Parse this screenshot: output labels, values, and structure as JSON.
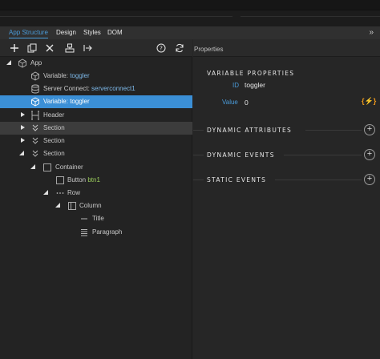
{
  "tabs": [
    {
      "label": "App Structure",
      "active": true
    },
    {
      "label": "Design",
      "active": false
    },
    {
      "label": "Styles",
      "active": false
    },
    {
      "label": "DOM",
      "active": false
    }
  ],
  "toolbar": {
    "icons": [
      "plus-icon",
      "copy-icon",
      "close-icon",
      "component-icon",
      "insert-arrow-icon",
      "help-icon",
      "refresh-icon"
    ]
  },
  "tree": [
    {
      "label": "App",
      "accent": "",
      "icon": "cube-icon",
      "twisty": "open"
    },
    {
      "label": "Variable: ",
      "accent": "toggler",
      "icon": "cube-icon",
      "twisty": ""
    },
    {
      "label": "Server Connect: ",
      "accent": "serverconnect1",
      "icon": "database-icon",
      "twisty": ""
    },
    {
      "label": "Variable: ",
      "accent": "toggler",
      "icon": "cube-icon",
      "twisty": "",
      "selected": true
    },
    {
      "label": "Header",
      "accent": "",
      "icon": "header-icon",
      "twisty": "closed"
    },
    {
      "label": "Section",
      "accent": "",
      "icon": "section-icon",
      "twisty": "closed",
      "highlight": true
    },
    {
      "label": "Section",
      "accent": "",
      "icon": "section-icon",
      "twisty": "closed"
    },
    {
      "label": "Section",
      "accent": "",
      "icon": "section-icon",
      "twisty": "open"
    },
    {
      "label": "Container",
      "accent": "",
      "icon": "container-icon",
      "twisty": "open"
    },
    {
      "label": "Button ",
      "accent": "btn1",
      "icon": "button-icon",
      "twisty": ""
    },
    {
      "label": "Row",
      "accent": "",
      "icon": "row-icon",
      "twisty": "open"
    },
    {
      "label": "Column",
      "accent": "",
      "icon": "column-icon",
      "twisty": "open"
    },
    {
      "label": "Title",
      "accent": "",
      "icon": "title-icon",
      "twisty": ""
    },
    {
      "label": "Paragraph",
      "accent": "",
      "icon": "paragraph-icon",
      "twisty": ""
    }
  ],
  "properties": {
    "title": "Properties",
    "section_variable": "VARIABLE PROPERTIES",
    "id_label": "ID",
    "id_value": "toggler",
    "value_label": "Value",
    "value_value": "0",
    "dynamic_button": "{⚡}",
    "dynamic_attributes": "DYNAMIC ATTRIBUTES",
    "dynamic_events": "DYNAMIC EVENTS",
    "static_events": "STATIC EVENTS",
    "plus_symbol": "+"
  },
  "collapse_symbol": "»",
  "colors": {
    "accent": "#3b8fd6",
    "green": "#9ccf5d",
    "orange": "#f09a1c"
  }
}
